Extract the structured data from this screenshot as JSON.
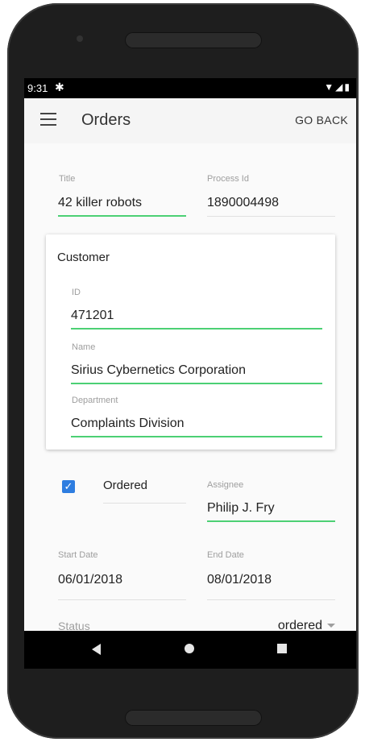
{
  "status_bar": {
    "time": "9:31",
    "settings_icon": "gear-icon",
    "signal_icons": "wifi-signal-battery-icons"
  },
  "app_bar": {
    "title": "Orders",
    "back_label": "GO BACK",
    "menu_icon": "menu-icon"
  },
  "form": {
    "title": {
      "label": "Title",
      "value": "42 killer robots"
    },
    "process_id": {
      "label": "Process Id",
      "value": "1890004498"
    },
    "customer": {
      "heading": "Customer",
      "id": {
        "label": "ID",
        "value": "471201"
      },
      "name": {
        "label": "Name",
        "value": "Sirius Cybernetics Corporation"
      },
      "department": {
        "label": "Department",
        "value": "Complaints Division"
      }
    },
    "ordered": {
      "label": "Ordered",
      "checked": true
    },
    "assignee": {
      "label": "Assignee",
      "value": "Philip J. Fry"
    },
    "start_date": {
      "label": "Start Date",
      "value": "06/01/2018"
    },
    "end_date": {
      "label": "End Date",
      "value": "08/01/2018"
    },
    "status": {
      "label": "Status",
      "value": "ordered"
    }
  },
  "colors": {
    "accent_underline": "#4cd074",
    "checkbox": "#2e7de0",
    "app_bar": "#f5f5f5"
  }
}
